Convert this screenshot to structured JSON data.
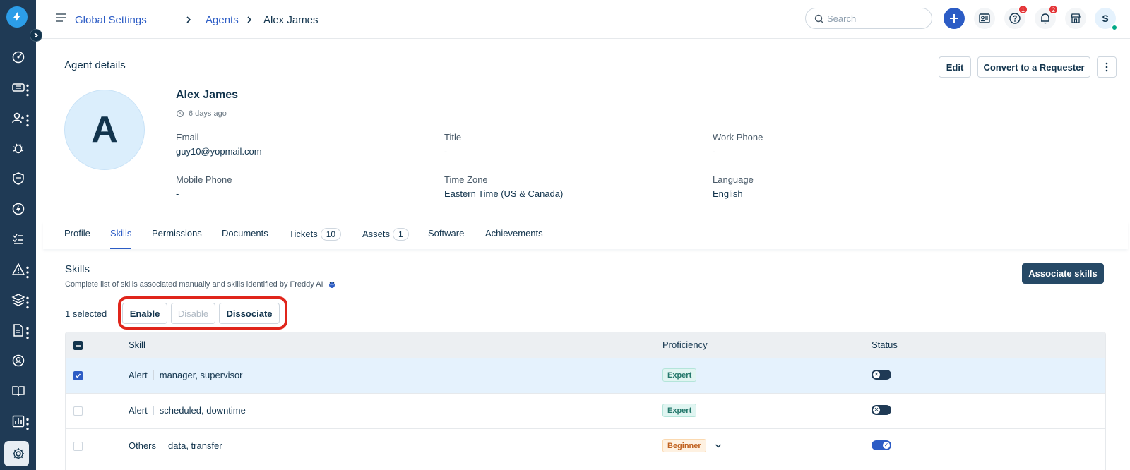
{
  "header": {
    "breadcrumbs": [
      "Global Settings",
      "Agents",
      "Alex James"
    ],
    "search_placeholder": "Search",
    "help_badge": "1",
    "notifications_badge": "2",
    "user_initial": "S"
  },
  "agent": {
    "section_title": "Agent details",
    "initial": "A",
    "name": "Alex James",
    "last_seen": "6 days ago",
    "fields": {
      "email_label": "Email",
      "email_value": "guy10@yopmail.com",
      "title_label": "Title",
      "title_value": "-",
      "work_phone_label": "Work Phone",
      "work_phone_value": "-",
      "mobile_label": "Mobile Phone",
      "mobile_value": "-",
      "timezone_label": "Time Zone",
      "timezone_value": "Eastern Time (US & Canada)",
      "language_label": "Language",
      "language_value": "English"
    },
    "actions": {
      "edit": "Edit",
      "convert": "Convert to a Requester"
    }
  },
  "tabs": [
    {
      "label": "Profile"
    },
    {
      "label": "Skills",
      "active": true
    },
    {
      "label": "Permissions"
    },
    {
      "label": "Documents"
    },
    {
      "label": "Tickets",
      "count": "10"
    },
    {
      "label": "Assets",
      "count": "1"
    },
    {
      "label": "Software"
    },
    {
      "label": "Achievements"
    }
  ],
  "skills": {
    "title": "Skills",
    "subtitle": "Complete list of skills associated manually and skills identified by Freddy AI",
    "associate_button": "Associate skills",
    "selected_text": "1 selected",
    "bulk_actions": {
      "enable": "Enable",
      "disable": "Disable",
      "dissociate": "Dissociate"
    },
    "columns": {
      "skill": "Skill",
      "proficiency": "Proficiency",
      "status": "Status"
    },
    "rows": [
      {
        "category": "Alert",
        "skill": "manager, supervisor",
        "proficiency": "Expert",
        "selected": true,
        "enabled": false
      },
      {
        "category": "Alert",
        "skill": "scheduled, downtime",
        "proficiency": "Expert",
        "selected": false,
        "enabled": false
      },
      {
        "category": "Others",
        "skill": "data, transfer",
        "proficiency": "Beginner",
        "selected": false,
        "enabled": true
      }
    ]
  },
  "colors": {
    "sidebar": "#1f3a55",
    "accent": "#2c5cc5",
    "highlight": "#e0251b"
  },
  "icons": {
    "sidebar": [
      "dashboard-icon",
      "tickets-icon",
      "users-icon",
      "bug-icon",
      "shield-icon",
      "bolt-icon",
      "checklist-icon",
      "alert-icon",
      "layers-icon",
      "document-icon",
      "support-icon",
      "book-icon",
      "chart-icon",
      "gear-icon"
    ]
  }
}
